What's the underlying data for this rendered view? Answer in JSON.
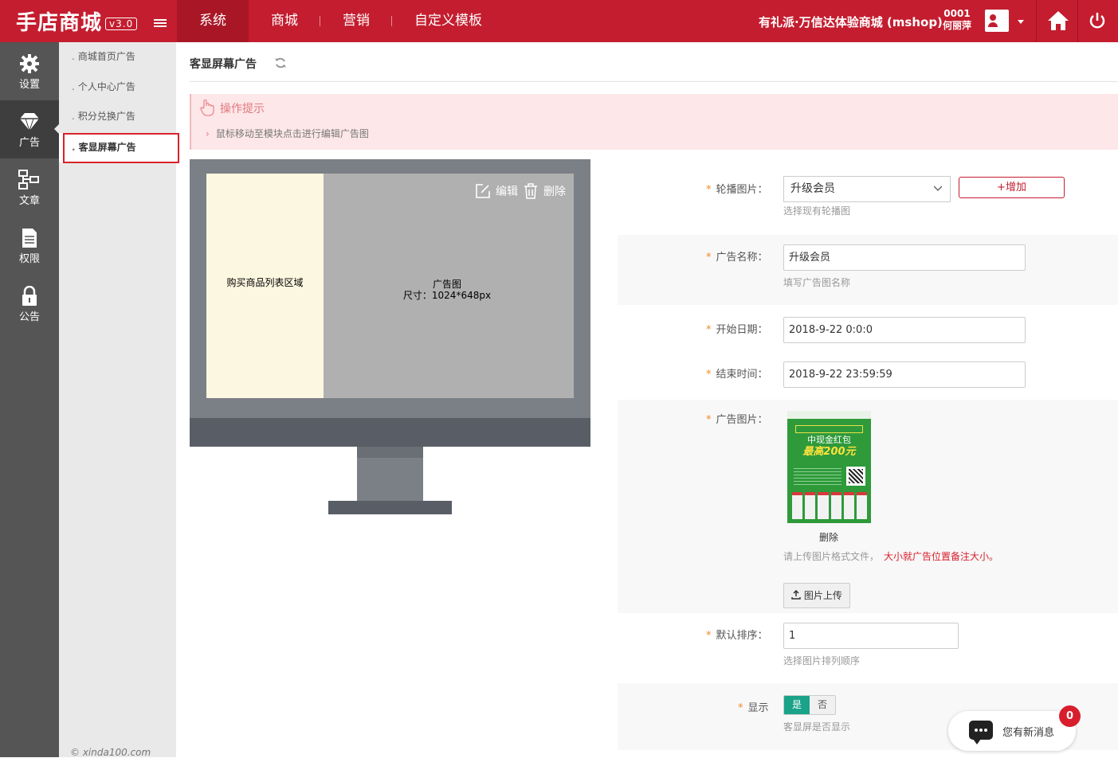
{
  "app": {
    "logo": "手店商城",
    "version": "v3.0"
  },
  "nav": {
    "items": [
      "系统",
      "商城",
      "营销",
      "自定义模板"
    ],
    "active": 0
  },
  "header": {
    "shop_name": "有礼派·万信达体验商城 (mshop)",
    "user_id": "0001",
    "user_name": "何丽萍"
  },
  "iconbar": [
    {
      "label": "设置",
      "icon": "gear-icon"
    },
    {
      "label": "广告",
      "icon": "diamond-icon"
    },
    {
      "label": "文章",
      "icon": "sitemap-icon"
    },
    {
      "label": "权限",
      "icon": "document-icon"
    },
    {
      "label": "公告",
      "icon": "lock-icon"
    }
  ],
  "submenu": [
    "商城首页广告",
    "个人中心广告",
    "积分兑换广告",
    "客显屏幕广告"
  ],
  "copyright": "© xinda100.com",
  "page": {
    "title": "客显屏幕广告",
    "tips_title": "操作提示",
    "tips_body": "鼠标移动至模块点击进行编辑广告图"
  },
  "preview": {
    "left_label": "购买商品列表区域",
    "right_label_1": "广告图",
    "right_label_2": "尺寸：1024*648px",
    "edit_label": "编辑",
    "delete_label": "删除"
  },
  "form": {
    "carousel_label": "轮播图片：",
    "carousel_value": "升级会员",
    "carousel_hint": "选择现有轮播图",
    "add_label": "+增加",
    "name_label": "广告名称：",
    "name_value": "升级会员",
    "name_hint": "填写广告图名称",
    "start_label": "开始日期：",
    "start_value": "2018-9-22 0:0:0",
    "end_label": "结束时间：",
    "end_value": "2018-9-22 23:59:59",
    "image_label": "广告图片：",
    "image_title": "中现金红包",
    "image_subtitle": "最高200元",
    "image_delete": "删除",
    "upload_hint": "请上传图片格式文件，",
    "upload_hint_red": "大小就广告位置备注大小。",
    "upload_button": "图片上传",
    "sort_label": "默认排序：",
    "sort_value": "1",
    "sort_hint": "选择图片排列顺序",
    "show_label": "显示",
    "show_yes": "是",
    "show_no": "否",
    "show_hint": "客显屏是否显示"
  },
  "message": {
    "text": "您有新消息",
    "count": "0"
  },
  "colors": {
    "brand": "#c41d2f",
    "toggle_on": "#1ba389",
    "tips_bg": "#fde7e8"
  }
}
